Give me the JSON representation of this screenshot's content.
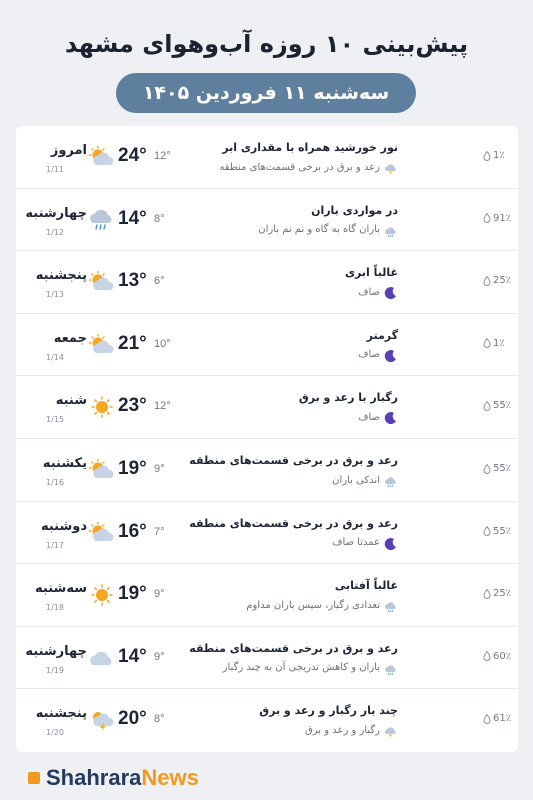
{
  "page": {
    "title": "پیش‌بینی ۱۰ روزه آب‌وهوای مشهد",
    "date_label": "سه‌شنبه ۱۱ فروردین ۱۴۰۵"
  },
  "days": [
    {
      "name": "امروز",
      "date": "1/11",
      "high": "24°",
      "low": "12°",
      "icon": "partly-cloudy-sun-icon",
      "condition": "نور خورشید همراه با مقداری ابر",
      "night_icon": "thunder-cloud-icon",
      "night": "رعد و برق در برخی قسمت‌های منطقه",
      "precip": "1٪"
    },
    {
      "name": "چهارشنبه",
      "date": "1/12",
      "high": "14°",
      "low": "8°",
      "icon": "rain-cloud-icon",
      "condition": "در مواردی باران",
      "night_icon": "rain-cloud-icon",
      "night": "باران گاه به گاه و نم نم باران",
      "precip": "91٪"
    },
    {
      "name": "پنجشنبه",
      "date": "1/13",
      "high": "13°",
      "low": "6°",
      "icon": "partly-cloudy-sun-icon",
      "condition": "غالباً ابری",
      "night_icon": "moon-icon",
      "night": "صاف",
      "precip": "25٪"
    },
    {
      "name": "جمعه",
      "date": "1/14",
      "high": "21°",
      "low": "10°",
      "icon": "partly-cloudy-sun-icon",
      "condition": "گرمتر",
      "night_icon": "moon-icon",
      "night": "صاف",
      "precip": "1٪"
    },
    {
      "name": "شنبه",
      "date": "1/15",
      "high": "23°",
      "low": "12°",
      "icon": "sun-icon",
      "condition": "رگبار با رعد و برق",
      "night_icon": "moon-icon",
      "night": "صاف",
      "precip": "55٪"
    },
    {
      "name": "یکشنبه",
      "date": "1/16",
      "high": "19°",
      "low": "9°",
      "icon": "partly-cloudy-sun-icon",
      "condition": "رعد و برق در برخی قسمت‌های منطقه",
      "night_icon": "rain-cloud-icon",
      "night": "اندکی باران",
      "precip": "55٪"
    },
    {
      "name": "دوشنبه",
      "date": "1/17",
      "high": "16°",
      "low": "7°",
      "icon": "partly-cloudy-sun-icon",
      "condition": "رعد و برق در برخی قسمت‌های منطقه",
      "night_icon": "moon-icon",
      "night": "عمدتا صاف",
      "precip": "55٪"
    },
    {
      "name": "سه‌شنبه",
      "date": "1/18",
      "high": "19°",
      "low": "9°",
      "icon": "sun-icon",
      "condition": "غالباً آفتابی",
      "night_icon": "rain-cloud-icon",
      "night": "تعدادی رگبار، سپس باران مداوم",
      "precip": "25٪"
    },
    {
      "name": "چهارشنبه",
      "date": "1/19",
      "high": "14°",
      "low": "9°",
      "icon": "cloud-icon",
      "condition": "رعد و برق در برخی قسمت‌های منطقه",
      "night_icon": "rain-cloud-icon",
      "night": "باران و کاهش تدریجی آن به چند رگبار",
      "precip": "60٪"
    },
    {
      "name": "پنجشنبه",
      "date": "1/20",
      "high": "20°",
      "low": "8°",
      "icon": "thunder-sun-icon",
      "condition": "چند بار رگبار و رعد و برق",
      "night_icon": "thunder-cloud-icon",
      "night": "رگبار و رعد و برق",
      "precip": "61٪"
    }
  ],
  "footer": {
    "brand_prefix": "Shahrara",
    "brand_suffix": "News",
    "brand_color": "#f39a1e"
  },
  "colors": {
    "pill": "#5e7f9e",
    "sun": "#f5a623",
    "cloud": "#c7d4e4",
    "moon": "#5b3fb6",
    "lightning": "#f0b429"
  }
}
